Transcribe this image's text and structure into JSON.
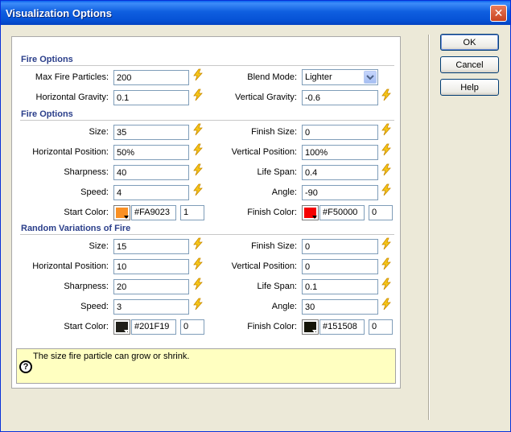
{
  "window": {
    "title": "Visualization Options"
  },
  "buttons": {
    "ok": "OK",
    "cancel": "Cancel",
    "help": "Help"
  },
  "sections": {
    "fire_options_1": "Fire Options",
    "fire_options_2": "Fire Options",
    "random_variations": "Random Variations of Fire"
  },
  "fire_options_1": {
    "max_fire_particles": {
      "label": "Max Fire Particles:",
      "value": "200"
    },
    "blend_mode": {
      "label": "Blend Mode:",
      "value": "Lighter"
    },
    "horizontal_gravity": {
      "label": "Horizontal Gravity:",
      "value": "0.1"
    },
    "vertical_gravity": {
      "label": "Vertical Gravity:",
      "value": "-0.6"
    }
  },
  "fire_options_2": {
    "size": {
      "label": "Size:",
      "value": "35"
    },
    "finish_size": {
      "label": "Finish Size:",
      "value": "0"
    },
    "horizontal_position": {
      "label": "Horizontal Position:",
      "value": "50%"
    },
    "vertical_position": {
      "label": "Vertical Position:",
      "value": "100%"
    },
    "sharpness": {
      "label": "Sharpness:",
      "value": "40"
    },
    "life_span": {
      "label": "Life Span:",
      "value": "0.4"
    },
    "speed": {
      "label": "Speed:",
      "value": "4"
    },
    "angle": {
      "label": "Angle:",
      "value": "-90"
    },
    "start_color": {
      "label": "Start Color:",
      "hex": "#FA9023",
      "alpha": "1",
      "swatch": "#FA9023"
    },
    "finish_color": {
      "label": "Finish Color:",
      "hex": "#F50000",
      "alpha": "0",
      "swatch": "#F50000"
    }
  },
  "random_variations": {
    "size": {
      "label": "Size:",
      "value": "15"
    },
    "finish_size": {
      "label": "Finish Size:",
      "value": "0"
    },
    "horizontal_position": {
      "label": "Horizontal Position:",
      "value": "10"
    },
    "vertical_position": {
      "label": "Vertical Position:",
      "value": "0"
    },
    "sharpness": {
      "label": "Sharpness:",
      "value": "20"
    },
    "life_span": {
      "label": "Life Span:",
      "value": "0.1"
    },
    "speed": {
      "label": "Speed:",
      "value": "3"
    },
    "angle": {
      "label": "Angle:",
      "value": "30"
    },
    "start_color": {
      "label": "Start Color:",
      "hex": "#201F19",
      "alpha": "0",
      "swatch": "#201F19"
    },
    "finish_color": {
      "label": "Finish Color:",
      "hex": "#151508",
      "alpha": "0",
      "swatch": "#151508"
    }
  },
  "help_text": "The size fire particle can grow or shrink.",
  "icons": {
    "bolt": "lightning-bolt-icon",
    "help": "question-icon",
    "close": "close-icon"
  },
  "colors": {
    "section_title": "#2a3e8a",
    "titlebar": "#0652d6",
    "help_bg": "#ffffc1"
  }
}
